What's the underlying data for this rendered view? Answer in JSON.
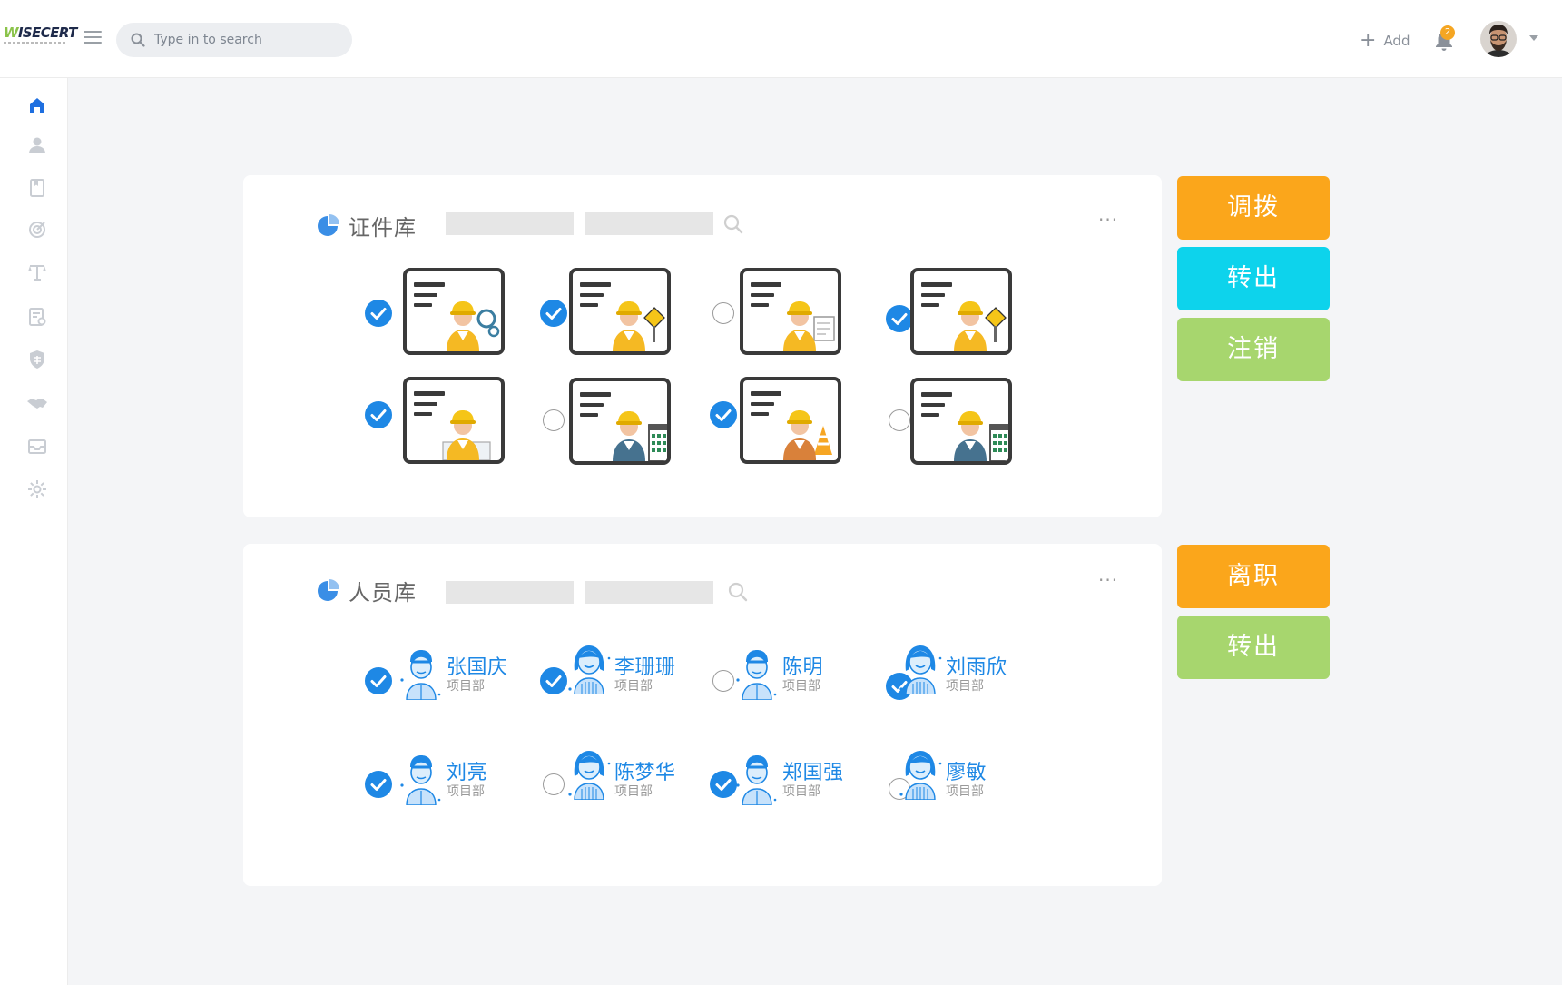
{
  "app": {
    "logo_text": "WISECERT",
    "search_placeholder": "Type in to search",
    "add_label": "Add",
    "notification_count": "2"
  },
  "sidebar": {
    "items": [
      "home-icon",
      "user-icon",
      "book-icon",
      "target-icon",
      "scale-icon",
      "document-list-icon",
      "shield-icon",
      "handshake-icon",
      "inbox-icon",
      "gear-icon"
    ],
    "active": "home-icon"
  },
  "cert_panel": {
    "title": "证件库",
    "more_label": "···",
    "items": [
      {
        "selected": true,
        "variant": "gears"
      },
      {
        "selected": true,
        "variant": "sign"
      },
      {
        "selected": false,
        "variant": "document"
      },
      {
        "selected": true,
        "variant": "sign"
      },
      {
        "selected": true,
        "variant": "plan"
      },
      {
        "selected": false,
        "variant": "building"
      },
      {
        "selected": true,
        "variant": "cone"
      },
      {
        "selected": false,
        "variant": "building"
      }
    ],
    "actions": [
      {
        "label": "调拨",
        "color": "#fba61b"
      },
      {
        "label": "转出",
        "color": "#0dd3ec"
      },
      {
        "label": "注销",
        "color": "#a7d66e"
      }
    ]
  },
  "staff_panel": {
    "title": "人员库",
    "more_label": "···",
    "people": [
      {
        "name": "张国庆",
        "dept": "项目部",
        "selected": true,
        "gender": "male"
      },
      {
        "name": "李珊珊",
        "dept": "项目部",
        "selected": true,
        "gender": "female"
      },
      {
        "name": "陈明",
        "dept": "项目部",
        "selected": false,
        "gender": "male"
      },
      {
        "name": "刘雨欣",
        "dept": "项目部",
        "selected": true,
        "gender": "female"
      },
      {
        "name": "刘亮",
        "dept": "项目部",
        "selected": true,
        "gender": "male"
      },
      {
        "name": "陈梦华",
        "dept": "项目部",
        "selected": false,
        "gender": "female"
      },
      {
        "name": "郑国强",
        "dept": "项目部",
        "selected": true,
        "gender": "male"
      },
      {
        "name": "廖敏",
        "dept": "项目部",
        "selected": false,
        "gender": "female"
      }
    ],
    "actions": [
      {
        "label": "离职",
        "color": "#fba61b"
      },
      {
        "label": "转出",
        "color": "#a7d66e"
      }
    ]
  }
}
